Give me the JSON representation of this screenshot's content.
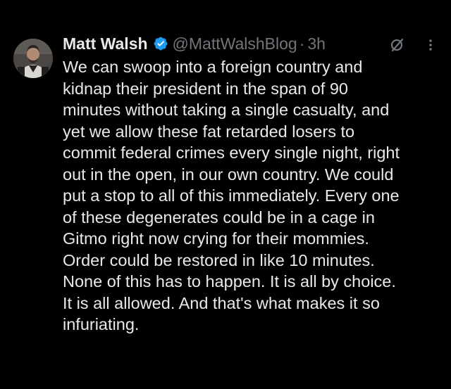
{
  "tweet": {
    "display_name": "Matt Walsh",
    "handle": "@MattWalshBlog",
    "separator": "·",
    "timestamp": "3h",
    "avatar_icon": "person-avatar",
    "verified_icon": "verified-badge-icon",
    "grok_icon": "grok-icon",
    "more_icon": "more-options-icon",
    "colors": {
      "background": "#000000",
      "text": "#e7e9ea",
      "secondary_text": "#71767b",
      "verified_badge": "#1d9bf0"
    },
    "body_lines": [
      "We can swoop into a foreign country and",
      "kidnap their president in the span of 90",
      "minutes without taking a single casualty, and",
      "yet we allow these fat retarded losers to",
      "commit federal crimes every single night, right",
      "out in the open, in our own country. We could",
      "put a stop to all of this immediately. Every one",
      "of these degenerates could be in a cage in",
      "Gitmo right now crying for their mommies.",
      "Order could be restored in like 10 minutes.",
      "None of this has to happen. It is all by choice.",
      "It is all allowed. And that's what makes it so",
      "infuriating."
    ]
  }
}
